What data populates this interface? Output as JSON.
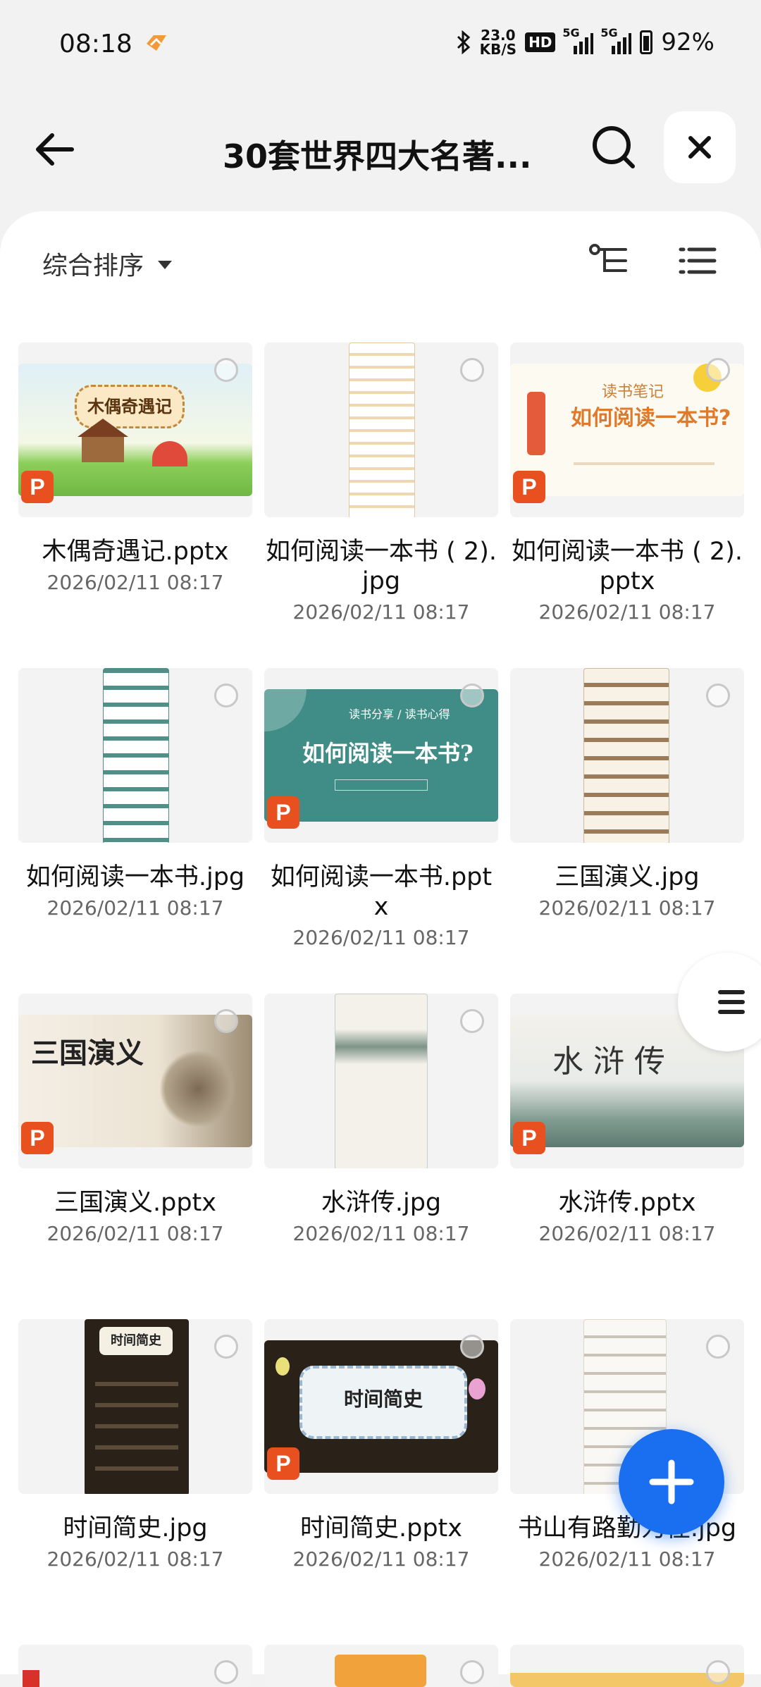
{
  "status": {
    "time": "08:18",
    "speed_value": "23.0",
    "speed_unit": "KB/S",
    "hd": "HD",
    "net1": "5G",
    "net2": "5G",
    "battery": "92%"
  },
  "header": {
    "title": "30套世界四大名著...",
    "back_icon": "arrow-left-icon",
    "search_icon": "search-icon",
    "close_icon": "close-icon"
  },
  "toolbar": {
    "sort_label": "综合排序",
    "icons": [
      "tree-view-icon",
      "list-view-icon"
    ]
  },
  "files": [
    {
      "name": "木偶奇遇记.pptx",
      "date": "2026/02/11 08:17",
      "type": "pptx"
    },
    {
      "name": "如何阅读一本书 ( 2).jpg",
      "date": "2026/02/11 08:17",
      "type": "jpg"
    },
    {
      "name": "如何阅读一本书 ( 2).pptx",
      "date": "2026/02/11 08:17",
      "type": "pptx"
    },
    {
      "name": "如何阅读一本书.jpg",
      "date": "2026/02/11 08:17",
      "type": "jpg"
    },
    {
      "name": "如何阅读一本书.pptx",
      "date": "2026/02/11 08:17",
      "type": "pptx"
    },
    {
      "name": "三国演义.jpg",
      "date": "2026/02/11 08:17",
      "type": "jpg"
    },
    {
      "name": "三国演义.pptx",
      "date": "2026/02/11 08:17",
      "type": "pptx"
    },
    {
      "name": "水浒传.jpg",
      "date": "2026/02/11 08:17",
      "type": "jpg"
    },
    {
      "name": "水浒传.pptx",
      "date": "2026/02/11 08:17",
      "type": "pptx"
    },
    {
      "name": "时间简史.jpg",
      "date": "2026/02/11 08:17",
      "type": "jpg"
    },
    {
      "name": "时间简史.pptx",
      "date": "2026/02/11 08:17",
      "type": "pptx"
    },
    {
      "name": "书山有路勤为径.jpg",
      "date": "2026/02/11 08:17",
      "type": "jpg"
    }
  ],
  "thumb_text": {
    "pinocchio": "木偶奇遇记",
    "reading_note_top": "读书笔记",
    "reading_note_main": "如何阅读一本书?",
    "reading_share_small": "读书分享 / 读书心得",
    "reading_share_main": "如何阅读一本书?",
    "sanguo_title": "三国演义",
    "shuihu_title": "水 浒 传",
    "shijian_title": "时间简史"
  },
  "ppt_badge_letter": "P",
  "colors": {
    "accent": "#1a6ff0",
    "ppt": "#e8501f",
    "panel": "#ffffff",
    "background": "#f2f2f2"
  }
}
